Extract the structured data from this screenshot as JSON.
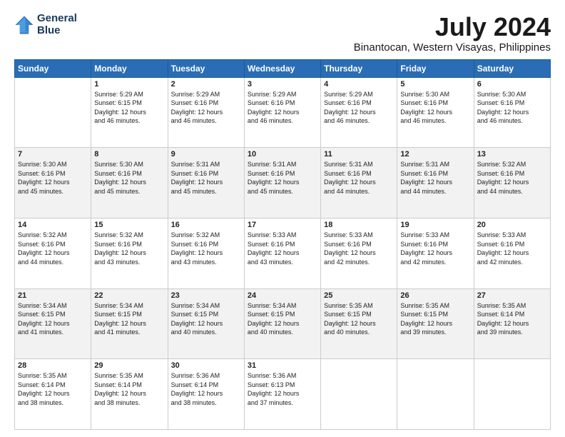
{
  "header": {
    "logo": {
      "line1": "General",
      "line2": "Blue"
    },
    "month": "July 2024",
    "location": "Binantocan, Western Visayas, Philippines"
  },
  "weekdays": [
    "Sunday",
    "Monday",
    "Tuesday",
    "Wednesday",
    "Thursday",
    "Friday",
    "Saturday"
  ],
  "weeks": [
    [
      {
        "day": "",
        "info": ""
      },
      {
        "day": "1",
        "info": "Sunrise: 5:29 AM\nSunset: 6:15 PM\nDaylight: 12 hours\nand 46 minutes."
      },
      {
        "day": "2",
        "info": "Sunrise: 5:29 AM\nSunset: 6:16 PM\nDaylight: 12 hours\nand 46 minutes."
      },
      {
        "day": "3",
        "info": "Sunrise: 5:29 AM\nSunset: 6:16 PM\nDaylight: 12 hours\nand 46 minutes."
      },
      {
        "day": "4",
        "info": "Sunrise: 5:29 AM\nSunset: 6:16 PM\nDaylight: 12 hours\nand 46 minutes."
      },
      {
        "day": "5",
        "info": "Sunrise: 5:30 AM\nSunset: 6:16 PM\nDaylight: 12 hours\nand 46 minutes."
      },
      {
        "day": "6",
        "info": "Sunrise: 5:30 AM\nSunset: 6:16 PM\nDaylight: 12 hours\nand 46 minutes."
      }
    ],
    [
      {
        "day": "7",
        "info": "Sunrise: 5:30 AM\nSunset: 6:16 PM\nDaylight: 12 hours\nand 45 minutes."
      },
      {
        "day": "8",
        "info": "Sunrise: 5:30 AM\nSunset: 6:16 PM\nDaylight: 12 hours\nand 45 minutes."
      },
      {
        "day": "9",
        "info": "Sunrise: 5:31 AM\nSunset: 6:16 PM\nDaylight: 12 hours\nand 45 minutes."
      },
      {
        "day": "10",
        "info": "Sunrise: 5:31 AM\nSunset: 6:16 PM\nDaylight: 12 hours\nand 45 minutes."
      },
      {
        "day": "11",
        "info": "Sunrise: 5:31 AM\nSunset: 6:16 PM\nDaylight: 12 hours\nand 44 minutes."
      },
      {
        "day": "12",
        "info": "Sunrise: 5:31 AM\nSunset: 6:16 PM\nDaylight: 12 hours\nand 44 minutes."
      },
      {
        "day": "13",
        "info": "Sunrise: 5:32 AM\nSunset: 6:16 PM\nDaylight: 12 hours\nand 44 minutes."
      }
    ],
    [
      {
        "day": "14",
        "info": "Sunrise: 5:32 AM\nSunset: 6:16 PM\nDaylight: 12 hours\nand 44 minutes."
      },
      {
        "day": "15",
        "info": "Sunrise: 5:32 AM\nSunset: 6:16 PM\nDaylight: 12 hours\nand 43 minutes."
      },
      {
        "day": "16",
        "info": "Sunrise: 5:32 AM\nSunset: 6:16 PM\nDaylight: 12 hours\nand 43 minutes."
      },
      {
        "day": "17",
        "info": "Sunrise: 5:33 AM\nSunset: 6:16 PM\nDaylight: 12 hours\nand 43 minutes."
      },
      {
        "day": "18",
        "info": "Sunrise: 5:33 AM\nSunset: 6:16 PM\nDaylight: 12 hours\nand 42 minutes."
      },
      {
        "day": "19",
        "info": "Sunrise: 5:33 AM\nSunset: 6:16 PM\nDaylight: 12 hours\nand 42 minutes."
      },
      {
        "day": "20",
        "info": "Sunrise: 5:33 AM\nSunset: 6:16 PM\nDaylight: 12 hours\nand 42 minutes."
      }
    ],
    [
      {
        "day": "21",
        "info": "Sunrise: 5:34 AM\nSunset: 6:15 PM\nDaylight: 12 hours\nand 41 minutes."
      },
      {
        "day": "22",
        "info": "Sunrise: 5:34 AM\nSunset: 6:15 PM\nDaylight: 12 hours\nand 41 minutes."
      },
      {
        "day": "23",
        "info": "Sunrise: 5:34 AM\nSunset: 6:15 PM\nDaylight: 12 hours\nand 40 minutes."
      },
      {
        "day": "24",
        "info": "Sunrise: 5:34 AM\nSunset: 6:15 PM\nDaylight: 12 hours\nand 40 minutes."
      },
      {
        "day": "25",
        "info": "Sunrise: 5:35 AM\nSunset: 6:15 PM\nDaylight: 12 hours\nand 40 minutes."
      },
      {
        "day": "26",
        "info": "Sunrise: 5:35 AM\nSunset: 6:15 PM\nDaylight: 12 hours\nand 39 minutes."
      },
      {
        "day": "27",
        "info": "Sunrise: 5:35 AM\nSunset: 6:14 PM\nDaylight: 12 hours\nand 39 minutes."
      }
    ],
    [
      {
        "day": "28",
        "info": "Sunrise: 5:35 AM\nSunset: 6:14 PM\nDaylight: 12 hours\nand 38 minutes."
      },
      {
        "day": "29",
        "info": "Sunrise: 5:35 AM\nSunset: 6:14 PM\nDaylight: 12 hours\nand 38 minutes."
      },
      {
        "day": "30",
        "info": "Sunrise: 5:36 AM\nSunset: 6:14 PM\nDaylight: 12 hours\nand 38 minutes."
      },
      {
        "day": "31",
        "info": "Sunrise: 5:36 AM\nSunset: 6:13 PM\nDaylight: 12 hours\nand 37 minutes."
      },
      {
        "day": "",
        "info": ""
      },
      {
        "day": "",
        "info": ""
      },
      {
        "day": "",
        "info": ""
      }
    ]
  ]
}
